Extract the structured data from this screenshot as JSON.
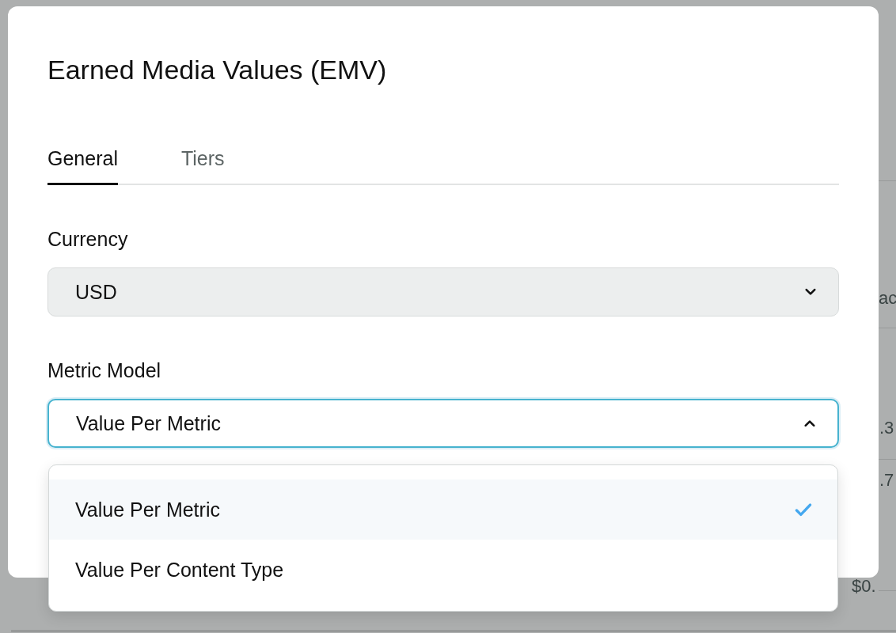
{
  "backdrop": {
    "cells": [
      "ac",
      ".3",
      ".7",
      "$0."
    ]
  },
  "dialog": {
    "title": "Earned Media Values (EMV)",
    "tabs": [
      {
        "label": "General",
        "selected": true
      },
      {
        "label": "Tiers",
        "selected": false
      }
    ],
    "fields": [
      {
        "label": "Currency",
        "value": "USD",
        "expanded": false
      },
      {
        "label": "Metric Model",
        "value": "Value Per Metric",
        "expanded": true
      }
    ]
  },
  "dropdown": {
    "options": [
      {
        "label": "Value Per Metric",
        "selected": true
      },
      {
        "label": "Value Per Content Type",
        "selected": false
      }
    ]
  }
}
